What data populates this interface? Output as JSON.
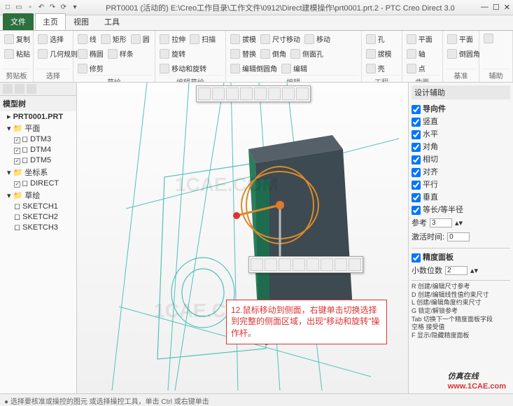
{
  "title": "PRT0001 (活动的) E:\\Creo工作目录\\工作文件\\0912\\Direct建模操作\\prt0001.prt.2 - PTC Creo Direct 3.0",
  "menu": {
    "file": "文件",
    "tabs": [
      "主页",
      "视图",
      "工具"
    ],
    "active": 0
  },
  "ribbon": {
    "groups": [
      {
        "label": "剪贴板",
        "items": [
          {
            "l": "复制"
          },
          {
            "l": "粘贴"
          }
        ]
      },
      {
        "label": "选择",
        "items": [
          {
            "l": "选择"
          },
          {
            "l": "几何规则"
          }
        ]
      },
      {
        "label": "草绘",
        "items": [
          {
            "l": "线"
          },
          {
            "l": "矩形"
          },
          {
            "l": "圆"
          },
          {
            "l": "椭圆"
          },
          {
            "l": "样条"
          },
          {
            "l": "修剪"
          }
        ]
      },
      {
        "label": "编辑草绘",
        "items": [
          {
            "l": "拉伸"
          },
          {
            "l": "扫描"
          },
          {
            "l": "旋转"
          },
          {
            "l": "移动和旋转"
          }
        ]
      },
      {
        "label": "编辑",
        "items": [
          {
            "l": "拔模"
          },
          {
            "l": "尺寸移动"
          },
          {
            "l": "移动"
          },
          {
            "l": "替换"
          },
          {
            "l": "倒角"
          },
          {
            "l": "侧面孔"
          },
          {
            "l": "编辑倒圆角"
          },
          {
            "l": "编辑"
          }
        ]
      },
      {
        "label": "工程",
        "items": [
          {
            "l": "孔"
          },
          {
            "l": "拔模"
          },
          {
            "l": "壳"
          }
        ]
      },
      {
        "label": "曲面",
        "items": [
          {
            "l": "平面"
          },
          {
            "l": "轴"
          },
          {
            "l": "点"
          }
        ]
      },
      {
        "label": "基准",
        "items": [
          {
            "l": "平面"
          },
          {
            "l": "倒圆角"
          }
        ]
      },
      {
        "label": "辅助",
        "items": [
          {
            "l": ""
          }
        ]
      }
    ]
  },
  "tree": {
    "title": "模型树",
    "root": "PRT0001.PRT",
    "nodes": [
      {
        "l": "平面",
        "children": [
          {
            "l": "DTM3",
            "ck": true
          },
          {
            "l": "DTM4",
            "ck": true
          },
          {
            "l": "DTM5",
            "ck": true
          }
        ]
      },
      {
        "l": "坐标系",
        "children": [
          {
            "l": "DIRECT",
            "ck": true
          }
        ]
      },
      {
        "l": "草绘",
        "children": [
          {
            "l": "SKETCH1"
          },
          {
            "l": "SKETCH2"
          },
          {
            "l": "SKETCH3"
          }
        ]
      }
    ]
  },
  "rpanel": {
    "title": "设计辅助",
    "guide_label": "导向件",
    "checks": [
      {
        "l": "竖直",
        "v": true
      },
      {
        "l": "水平",
        "v": true
      },
      {
        "l": "对角",
        "v": true
      },
      {
        "l": "相切",
        "v": true
      },
      {
        "l": "对齐",
        "v": true
      },
      {
        "l": "平行",
        "v": true
      },
      {
        "l": "垂直",
        "v": true
      },
      {
        "l": "等长/等半径",
        "v": true
      }
    ],
    "ref_label": "参考",
    "ref_value": "3",
    "act_label": "激活时间:",
    "act_value": "0",
    "grid_label": "精度面板",
    "grid_ck": true,
    "dec_label": "小数位数",
    "dec_value": "2",
    "help": "R 创建/编辑尺寸参考\nD 创建/编辑线性值约束尺寸\nL 创建/编辑角度约束尺寸\nG 锁定/解锁参考\nTab 切换下一个精度面板字段\n空格 接受值\nF 显示/隐藏精度面板"
  },
  "annotation": "12.鼠标移动到侧面，右键单击切换选择到完整的侧面区域，出现\"移动和旋转\"操作杆。",
  "status": "● 选择要核准或操控的图元 或选择操控工具，单击 Ctrl 或右键单击",
  "watermark": "1CAE.COM",
  "logo": {
    "text": "仿真在线",
    "url": "www.1CAE.com"
  }
}
